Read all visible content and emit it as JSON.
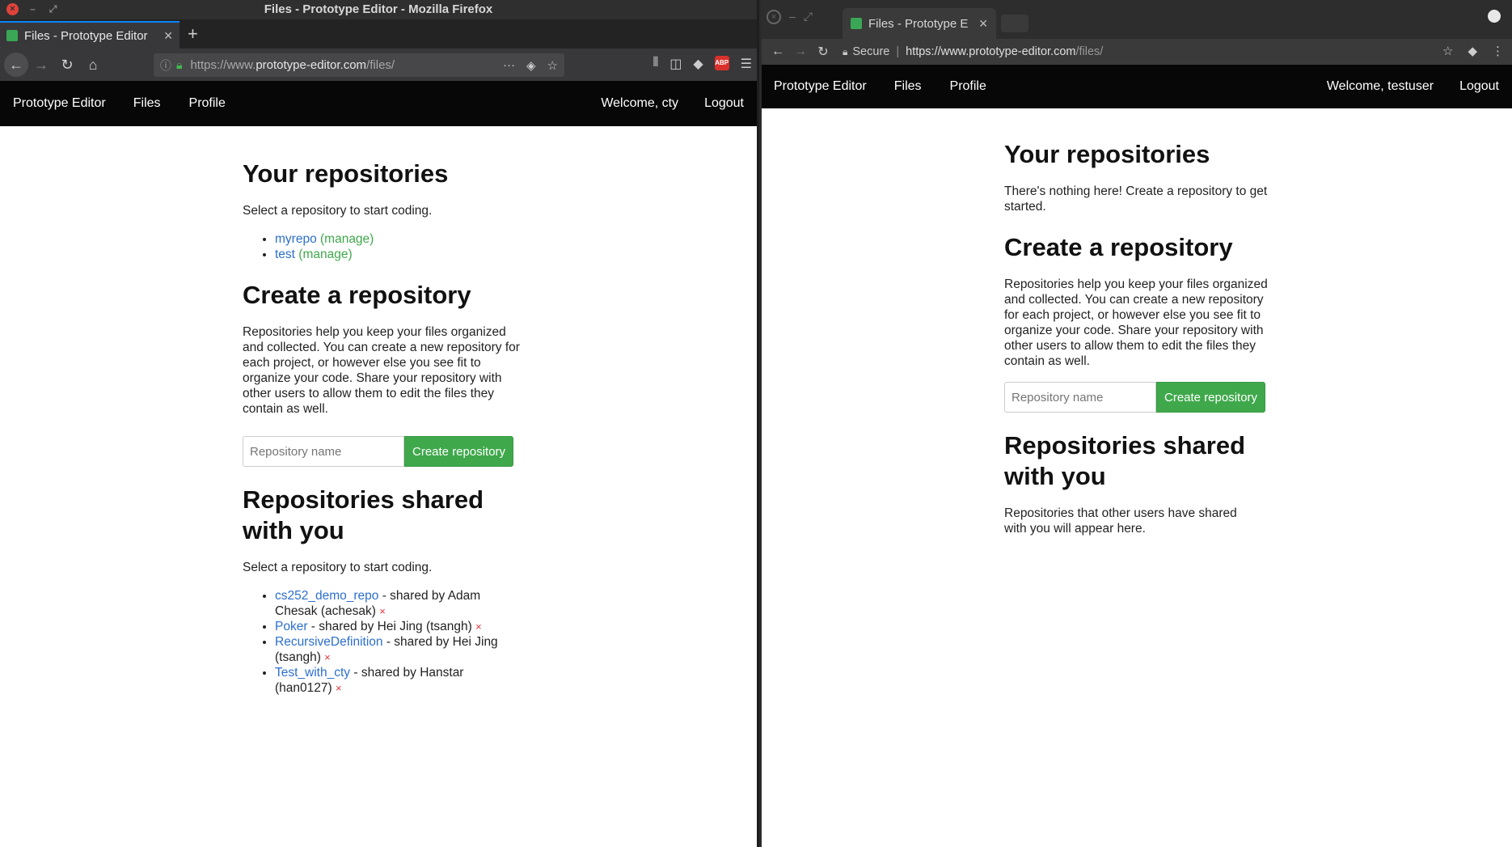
{
  "firefox": {
    "window_title": "Files - Prototype Editor - Mozilla Firefox",
    "tab_title": "Files - Prototype Editor",
    "url_prefix": "https://www.",
    "url_host": "prototype-editor.com",
    "url_path": "/files/",
    "overflow": "···"
  },
  "chrome": {
    "tab_title": "Files - Prototype E",
    "secure_label": "Secure",
    "url_prefix": "https://www.",
    "url_host": "prototype-editor.com",
    "url_path": "/files/"
  },
  "left_app": {
    "nav": {
      "brand": "Prototype Editor",
      "files": "Files",
      "profile": "Profile",
      "welcome": "Welcome, cty",
      "logout": "Logout"
    },
    "your_repos": {
      "heading": "Your repositories",
      "intro": "Select a repository to start coding.",
      "items": [
        {
          "name": "myrepo",
          "manage": "(manage)"
        },
        {
          "name": "test",
          "manage": "(manage)"
        }
      ]
    },
    "create": {
      "heading": "Create a repository",
      "description": "Repositories help you keep your files organized and collected. You can create a new repository for each project, or however else you see fit to organize your code. Share your repository with other users to allow them to edit the files they contain as well.",
      "placeholder": "Repository name",
      "button": "Create repository"
    },
    "shared": {
      "heading": "Repositories shared with you",
      "intro": "Select a repository to start coding.",
      "items": [
        {
          "name": "cs252_demo_repo",
          "by": " - shared by Adam Chesak (achesak) ",
          "remove": "×"
        },
        {
          "name": "Poker",
          "by": " - shared by Hei Jing (tsangh) ",
          "remove": "×"
        },
        {
          "name": "RecursiveDefinition",
          "by": " - shared by Hei Jing (tsangh) ",
          "remove": "×"
        },
        {
          "name": "Test_with_cty",
          "by": " - shared by Hanstar (han0127) ",
          "remove": "×"
        }
      ]
    }
  },
  "right_app": {
    "nav": {
      "brand": "Prototype Editor",
      "files": "Files",
      "profile": "Profile",
      "welcome": "Welcome, testuser",
      "logout": "Logout"
    },
    "your_repos": {
      "heading": "Your repositories",
      "empty": "There's nothing here! Create a repository to get started."
    },
    "create": {
      "heading": "Create a repository",
      "description": "Repositories help you keep your files organized and collected. You can create a new repository for each project, or however else you see fit to organize your code. Share your repository with other users to allow them to edit the files they contain as well.",
      "placeholder": "Repository name",
      "button": "Create repository"
    },
    "shared": {
      "heading": "Repositories shared with you",
      "empty": "Repositories that other users have shared with you will appear here."
    }
  },
  "colors": {
    "accent_green": "#3fa84b",
    "link_blue": "#2c6fcc",
    "remove_red": "#e0363a",
    "navbar": "#070707"
  }
}
